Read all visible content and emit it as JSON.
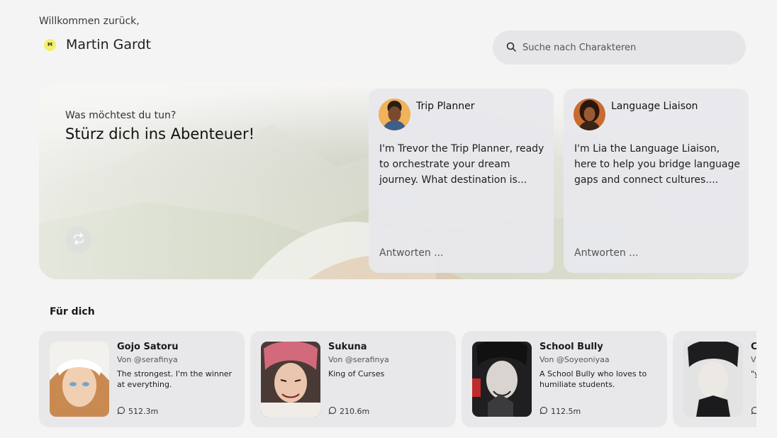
{
  "header": {
    "welcome": "Willkommen zurück,",
    "user_initial": "M",
    "user_name": "Martin Gardt"
  },
  "search": {
    "placeholder": "Suche nach Charakteren",
    "icon": "search-icon"
  },
  "hero": {
    "label": "Was möchtest du tun?",
    "title": "Stürz dich ins Abenteuer!",
    "refresh_icon": "refresh-icon"
  },
  "featured": [
    {
      "name": "Trip Planner",
      "description": "I'm Trevor the Trip Planner, ready to orchestrate your dream journey. What destination is...",
      "reply": "Antworten ..."
    },
    {
      "name": "Language Liaison",
      "description": "I'm Lia the Language Liaison, here to help you bridge language gaps and connect cultures....",
      "reply": "Antworten ..."
    }
  ],
  "for_you": {
    "title": "Für dich",
    "cards": [
      {
        "name": "Gojo Satoru",
        "author": "Von @serafinya",
        "description": "The strongest. I'm the winner at everything.",
        "count": "512.3m"
      },
      {
        "name": "Sukuna",
        "author": "Von @serafinya",
        "description": "King of Curses",
        "count": "210.6m"
      },
      {
        "name": "School Bully",
        "author": "Von @Soyeoniyaa",
        "description": "A School Bully who loves to humiliate students.",
        "count": "112.5m"
      },
      {
        "name": "C",
        "author": "V",
        "description": "\"y w ar",
        "count": ""
      }
    ]
  }
}
